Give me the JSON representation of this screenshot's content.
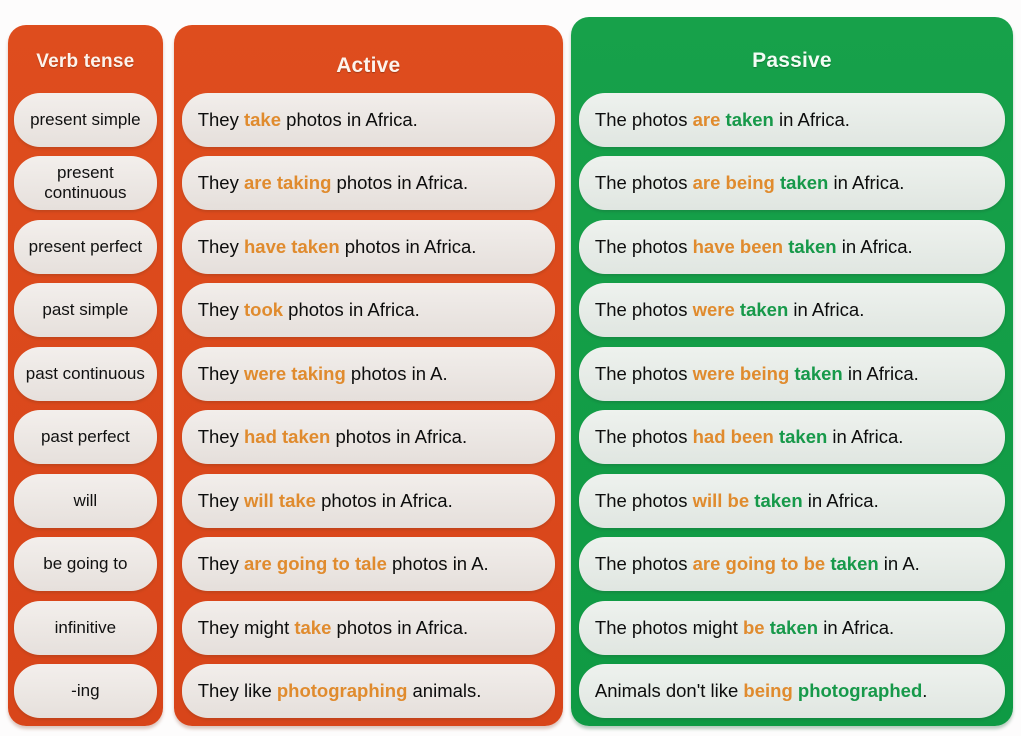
{
  "theme": {
    "orange_panel": "#dc4a1c",
    "green_panel": "#1ba14b",
    "pill_warm": "#ece7e4",
    "pill_cool": "#e7ece8",
    "highlight_orange": "#e08b2e",
    "highlight_green": "#17994a",
    "text_dark": "#0d0d0d",
    "header_text": "#fdf3ec"
  },
  "columns": {
    "tense_header": "Verb tense",
    "active_header": "Active",
    "passive_header": "Passive"
  },
  "rows": [
    {
      "tense": "present simple",
      "active": [
        {
          "text": "They ",
          "style": "plain"
        },
        {
          "text": "take",
          "style": "orange"
        },
        {
          "text": " photos in Africa.",
          "style": "plain"
        }
      ],
      "passive": [
        {
          "text": "The photos ",
          "style": "plain"
        },
        {
          "text": "are",
          "style": "orange"
        },
        {
          "text": " ",
          "style": "plain"
        },
        {
          "text": "taken",
          "style": "green"
        },
        {
          "text": " in Africa.",
          "style": "plain"
        }
      ]
    },
    {
      "tense": "present continuous",
      "active": [
        {
          "text": "They ",
          "style": "plain"
        },
        {
          "text": "are taking",
          "style": "orange"
        },
        {
          "text": " photos in Africa.",
          "style": "plain"
        }
      ],
      "passive": [
        {
          "text": "The photos ",
          "style": "plain"
        },
        {
          "text": "are being",
          "style": "orange"
        },
        {
          "text": " ",
          "style": "plain"
        },
        {
          "text": "taken",
          "style": "green"
        },
        {
          "text": " in Africa.",
          "style": "plain"
        }
      ]
    },
    {
      "tense": "present perfect",
      "active": [
        {
          "text": "They ",
          "style": "plain"
        },
        {
          "text": "have taken",
          "style": "orange"
        },
        {
          "text": " photos in Africa.",
          "style": "plain"
        }
      ],
      "passive": [
        {
          "text": "The photos ",
          "style": "plain"
        },
        {
          "text": "have been",
          "style": "orange"
        },
        {
          "text": " ",
          "style": "plain"
        },
        {
          "text": "taken",
          "style": "green"
        },
        {
          "text": " in Africa.",
          "style": "plain"
        }
      ]
    },
    {
      "tense": "past simple",
      "active": [
        {
          "text": "They ",
          "style": "plain"
        },
        {
          "text": "took",
          "style": "orange"
        },
        {
          "text": " photos in Africa.",
          "style": "plain"
        }
      ],
      "passive": [
        {
          "text": "The photos ",
          "style": "plain"
        },
        {
          "text": "were",
          "style": "orange"
        },
        {
          "text": " ",
          "style": "plain"
        },
        {
          "text": "taken",
          "style": "green"
        },
        {
          "text": " in Africa.",
          "style": "plain"
        }
      ]
    },
    {
      "tense": "past continuous",
      "active": [
        {
          "text": "They ",
          "style": "plain"
        },
        {
          "text": "were taking",
          "style": "orange"
        },
        {
          "text": " photos in A.",
          "style": "plain"
        }
      ],
      "passive": [
        {
          "text": "The photos ",
          "style": "plain"
        },
        {
          "text": "were being",
          "style": "orange"
        },
        {
          "text": " ",
          "style": "plain"
        },
        {
          "text": "taken",
          "style": "green"
        },
        {
          "text": " in Africa.",
          "style": "plain"
        }
      ]
    },
    {
      "tense": "past perfect",
      "active": [
        {
          "text": "They ",
          "style": "plain"
        },
        {
          "text": "had taken",
          "style": "orange"
        },
        {
          "text": " photos in Africa.",
          "style": "plain"
        }
      ],
      "passive": [
        {
          "text": "The photos ",
          "style": "plain"
        },
        {
          "text": "had been",
          "style": "orange"
        },
        {
          "text": " ",
          "style": "plain"
        },
        {
          "text": "taken",
          "style": "green"
        },
        {
          "text": " in Africa.",
          "style": "plain"
        }
      ]
    },
    {
      "tense": "will",
      "active": [
        {
          "text": "They ",
          "style": "plain"
        },
        {
          "text": "will take",
          "style": "orange"
        },
        {
          "text": " photos in Africa.",
          "style": "plain"
        }
      ],
      "passive": [
        {
          "text": "The photos ",
          "style": "plain"
        },
        {
          "text": "will be",
          "style": "orange"
        },
        {
          "text": " ",
          "style": "plain"
        },
        {
          "text": "taken",
          "style": "green"
        },
        {
          "text": " in Africa.",
          "style": "plain"
        }
      ]
    },
    {
      "tense": "be going to",
      "active": [
        {
          "text": "They ",
          "style": "plain"
        },
        {
          "text": "are going to tale",
          "style": "orange"
        },
        {
          "text": " photos in A.",
          "style": "plain"
        }
      ],
      "passive": [
        {
          "text": "The photos ",
          "style": "plain"
        },
        {
          "text": "are going to be",
          "style": "orange"
        },
        {
          "text": " ",
          "style": "plain"
        },
        {
          "text": "taken",
          "style": "green"
        },
        {
          "text": " in A.",
          "style": "plain"
        }
      ]
    },
    {
      "tense": "infinitive",
      "active": [
        {
          "text": "They might ",
          "style": "plain"
        },
        {
          "text": "take",
          "style": "orange"
        },
        {
          "text": " photos in Africa.",
          "style": "plain"
        }
      ],
      "passive": [
        {
          "text": "The photos might ",
          "style": "plain"
        },
        {
          "text": "be",
          "style": "orange"
        },
        {
          "text": " ",
          "style": "plain"
        },
        {
          "text": "taken",
          "style": "green"
        },
        {
          "text": " in Africa.",
          "style": "plain"
        }
      ]
    },
    {
      "tense": "-ing",
      "active": [
        {
          "text": "They like ",
          "style": "plain"
        },
        {
          "text": "photographing",
          "style": "orange"
        },
        {
          "text": " animals.",
          "style": "plain"
        }
      ],
      "passive": [
        {
          "text": "Animals don't like ",
          "style": "plain"
        },
        {
          "text": "being",
          "style": "orange"
        },
        {
          "text": " ",
          "style": "plain"
        },
        {
          "text": "photographed",
          "style": "green"
        },
        {
          "text": ".",
          "style": "plain"
        }
      ]
    }
  ]
}
